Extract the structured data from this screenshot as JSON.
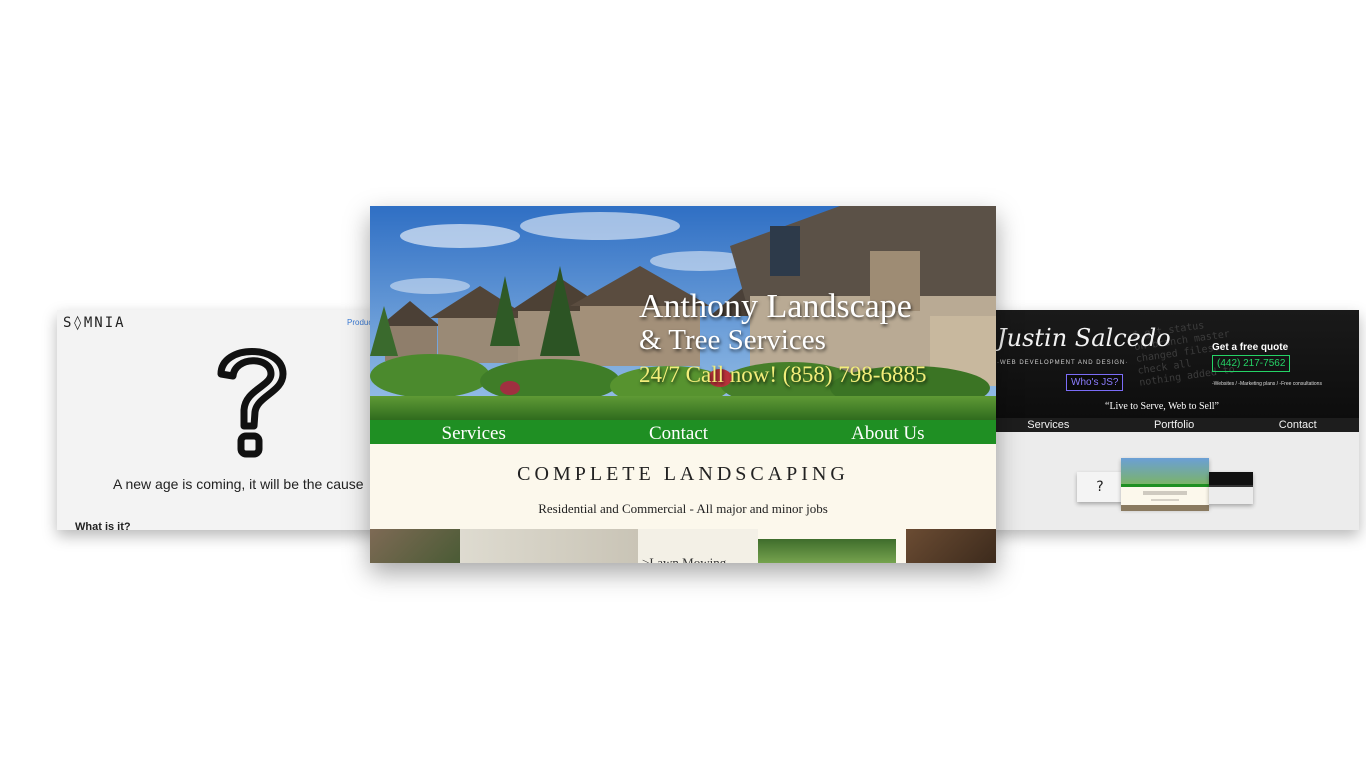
{
  "somnia": {
    "logo": "S◊MNIA",
    "nav_item": "Produc",
    "tagline": "A new age is coming, it will be the cause",
    "subhead": "What is it?"
  },
  "justin": {
    "signature": "Justin Salcedo",
    "tagline_small": "·WEB DEVELOPMENT AND DESIGN·",
    "button": "Who's JS?",
    "quote_title": "Get a free quote",
    "phone": "(442) 217-7562",
    "offers": "-Websites / -Marketing plans / -Free consultations",
    "motto": "“Live to Serve, Web to Sell”",
    "nav": [
      "Services",
      "Portfolio",
      "Contact"
    ],
    "bg_code": "$ git status\non branch master\nchanged files:\ncheck all\nnothing added to"
  },
  "anthony": {
    "title": "Anthony Landscape",
    "subtitle": "& Tree Services",
    "phone": "24/7 Call now! (858) 798-6885",
    "nav": [
      "Services",
      "Contact",
      "About Us"
    ],
    "section_title": "COMPLETE LANDSCAPING",
    "section_sub": "Residential and Commercial - All major and minor jobs",
    "service_label": ">Lawn Mowing"
  },
  "colors": {
    "nav_green": "#1f8f23",
    "phone_yellow": "#f3ee7a",
    "accent_purple": "#7b6cf7",
    "accent_green": "#25d366",
    "cream": "#fcf8ec"
  }
}
